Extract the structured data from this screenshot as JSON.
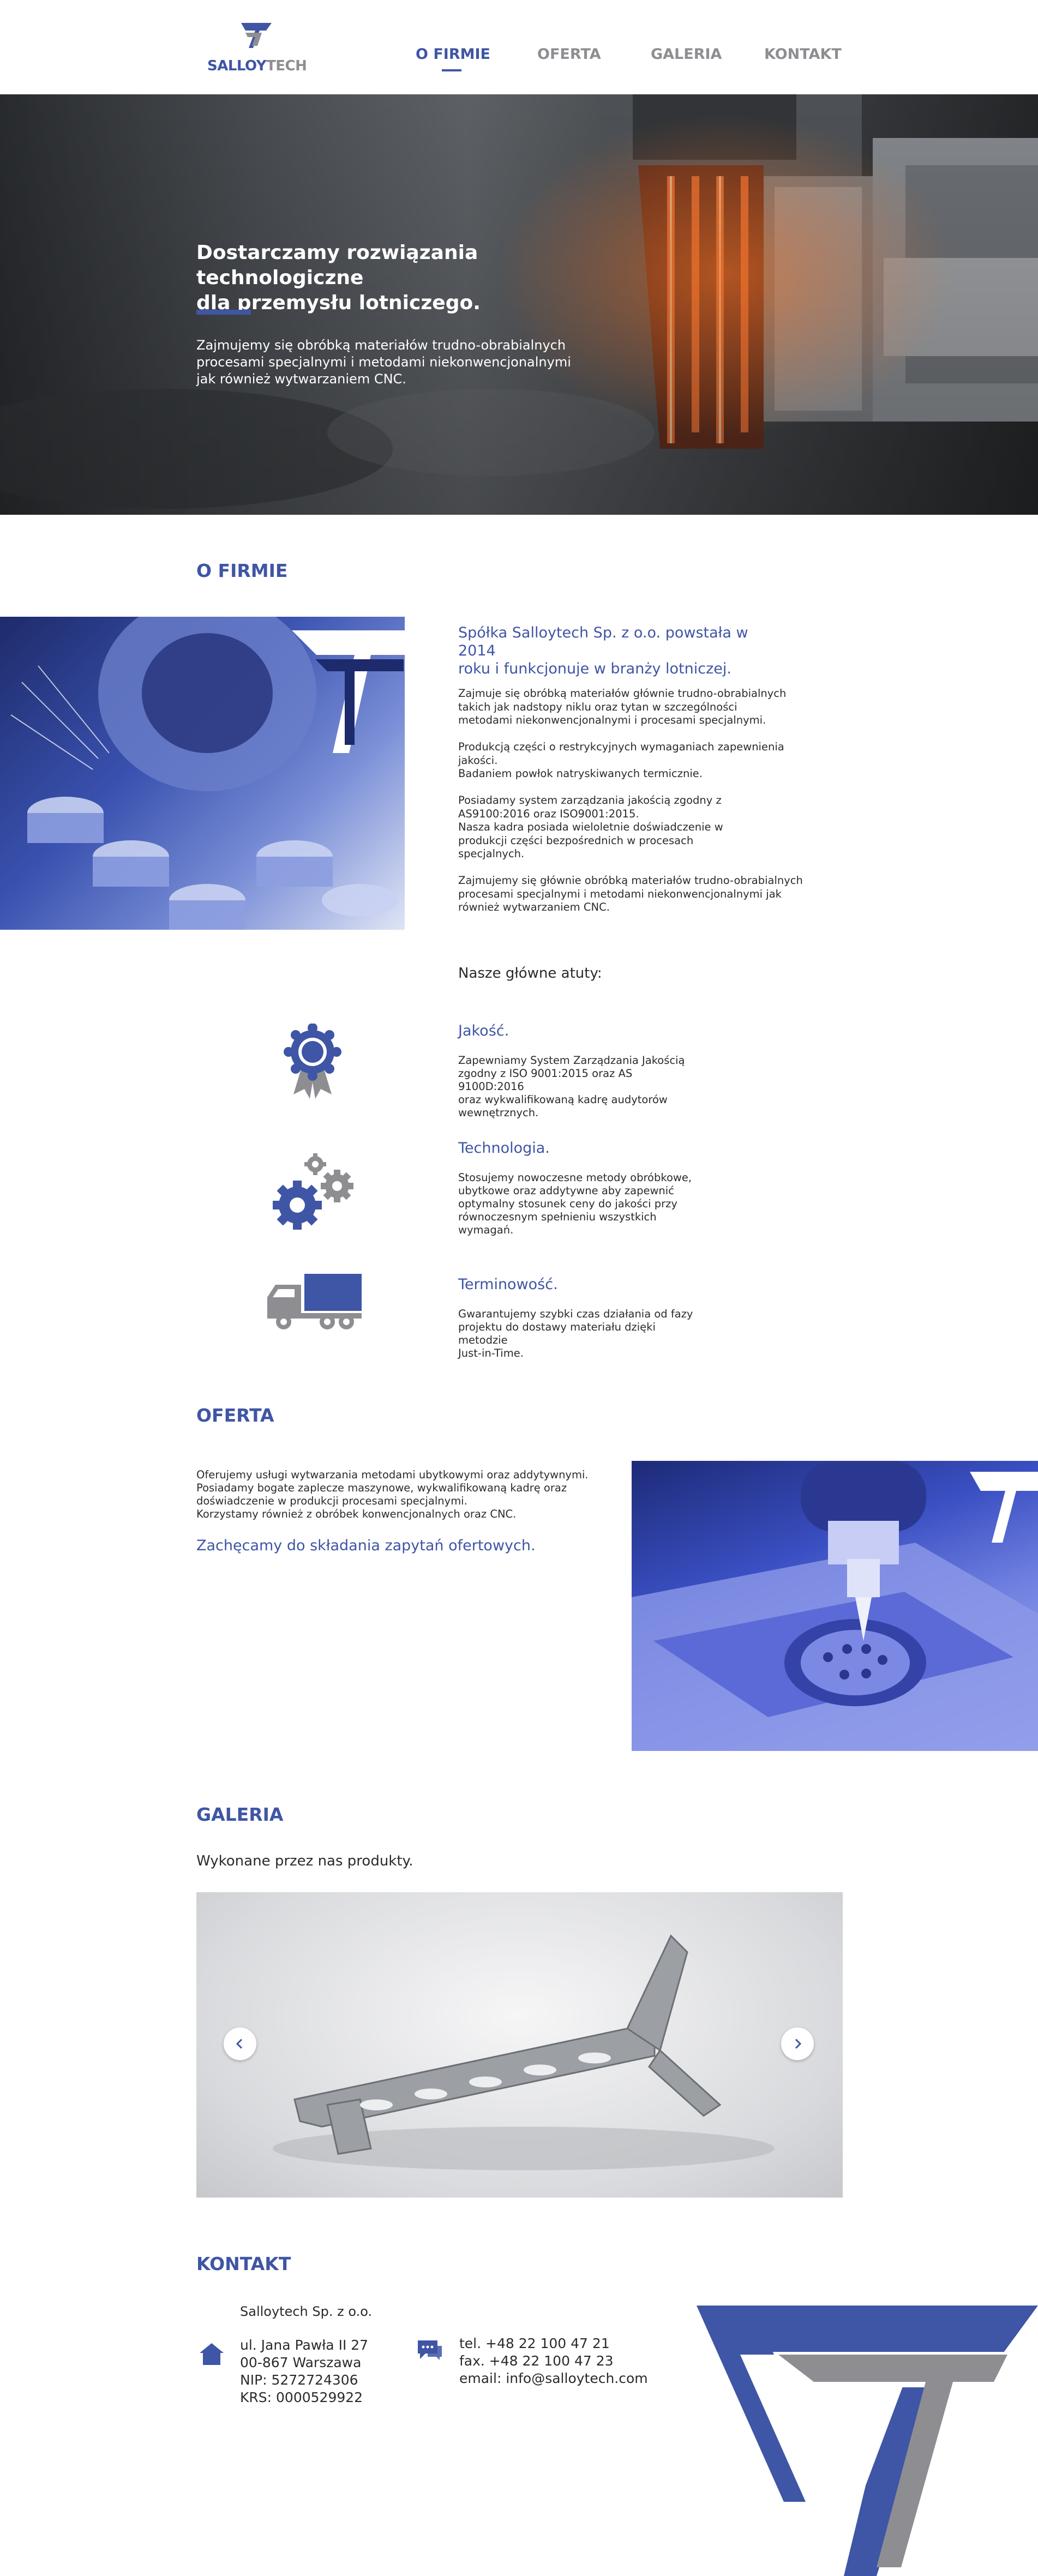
{
  "header": {
    "logo_text_part1": "SALLOY",
    "logo_text_part2": "TECH",
    "nav": [
      {
        "label": "O FIRMIE",
        "active": true
      },
      {
        "label": "OFERTA",
        "active": false
      },
      {
        "label": "GALERIA",
        "active": false
      },
      {
        "label": "KONTAKT",
        "active": false
      }
    ]
  },
  "hero": {
    "title_line1": "Dostarczamy rozwiązania technologiczne",
    "title_line2": "dla przemysłu lotniczego.",
    "subtitle_line1": "Zajmujemy się obróbką materiałów trudno-obrabialnych",
    "subtitle_line2": "procesami specjalnymi i metodami niekonwencjonalnymi",
    "subtitle_line3": "jak również wytwarzaniem CNC."
  },
  "about": {
    "title": "O FIRMIE",
    "lead_line1": "Spółka Salloytech Sp. z o.o. powstała w 2014",
    "lead_line2": "roku i funkcjonuje w branży lotniczej.",
    "paragraphs": [
      [
        "Zajmuje się obróbką materiałów głównie trudno-obrabialnych",
        "takich jak nadstopy niklu oraz tytan w szczególności",
        "metodami niekonwencjonalnymi i procesami specjalnymi."
      ],
      [
        "Produkcją części o restrykcyjnych wymaganiach zapewnienia jakości.",
        "Badaniem powłok natryskiwanych termicznie."
      ],
      [
        "Posiadamy system zarządzania jakością zgodny z",
        "AS9100:2016 oraz ISO9001:2015.",
        "Nasza kadra posiada wieloletnie doświadczenie w",
        "produkcji części bezpośrednich w procesach",
        "specjalnych."
      ],
      [
        "Zajmujemy się głównie obróbką materiałów trudno-obrabialnych",
        "procesami specjalnymi i metodami niekonwencjonalnymi jak",
        "również wytwarzaniem CNC."
      ]
    ],
    "atuty_heading": "Nasze główne atuty:",
    "atuty": [
      {
        "title": "Jakość.",
        "icon": "award-icon",
        "lines": [
          "Zapewniamy System Zarządzania Jakością",
          "zgodny z ISO 9001:2015 oraz AS 9100D:2016",
          "oraz wykwalifikowaną kadrę audytorów",
          "wewnętrznych."
        ]
      },
      {
        "title": "Technologia.",
        "icon": "gears-icon",
        "lines": [
          "Stosujemy nowoczesne metody obróbkowe,",
          "ubytkowe oraz addytywne aby zapewnić",
          "optymalny stosunek ceny do jakości przy",
          "równoczesnym spełnieniu wszystkich",
          "wymagań."
        ]
      },
      {
        "title": "Terminowość.",
        "icon": "truck-icon",
        "lines": [
          "Gwarantujemy szybki czas działania od fazy",
          "projektu do dostawy materiału dzięki metodzie",
          "Just-in-Time."
        ]
      }
    ]
  },
  "oferta": {
    "title": "OFERTA",
    "lines": [
      "Oferujemy usługi wytwarzania metodami ubytkowymi oraz addytywnymi.",
      "Posiadamy bogate zaplecze maszynowe, wykwalifikowaną kadrę oraz",
      "doświadczenie w produkcji procesami specjalnymi.",
      "Korzystamy również z obróbek konwencjonalnych oraz CNC."
    ],
    "cta": "Zachęcamy do składania zapytań ofertowych."
  },
  "galeria": {
    "title": "GALERIA",
    "subtitle": "Wykonane przez nas produkty."
  },
  "kontakt": {
    "title": "KONTAKT",
    "company": "Salloytech Sp. z o.o.",
    "address": [
      "ul. Jana Pawła II 27",
      "00-867 Warszawa",
      "NIP: 5272724306",
      "KRS: 0000529922"
    ],
    "phone": [
      "tel. +48 22 100 47 21",
      "fax. +48 22 100 47 23",
      "email: info@salloytech.com"
    ]
  },
  "colors": {
    "brand_blue": "#3f55a5",
    "brand_gray": "#8e8e92"
  }
}
